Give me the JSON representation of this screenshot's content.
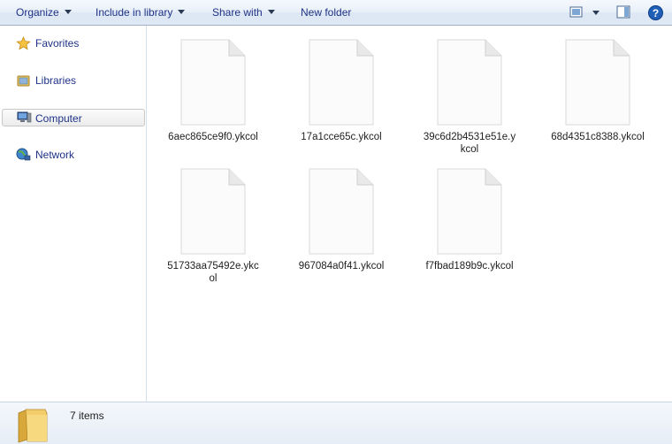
{
  "toolbar": {
    "organize": "Organize",
    "include_in_library": "Include in library",
    "share_with": "Share with",
    "new_folder": "New folder"
  },
  "nav": {
    "items": [
      {
        "label": "Favorites",
        "icon": "star-icon"
      },
      {
        "label": "Libraries",
        "icon": "library-icon"
      },
      {
        "label": "Computer",
        "icon": "computer-icon",
        "selected": true
      },
      {
        "label": "Network",
        "icon": "network-icon"
      }
    ]
  },
  "files": [
    {
      "name": "6aec865ce9f0.ykcol"
    },
    {
      "name": "17a1cce65c.ykcol"
    },
    {
      "name": "39c6d2b4531e51e.ykcol"
    },
    {
      "name": "68d4351c8388.ykcol"
    },
    {
      "name": "51733aa75492e.ykcol"
    },
    {
      "name": "967084a0f41.ykcol"
    },
    {
      "name": "f7fbad189b9c.ykcol"
    }
  ],
  "details": {
    "count": "7 items"
  },
  "colors": {
    "toolbar_text": "#1e3287",
    "toolbar_bg": "#e9f0f8",
    "selected_nav_bg": "#ececec"
  }
}
